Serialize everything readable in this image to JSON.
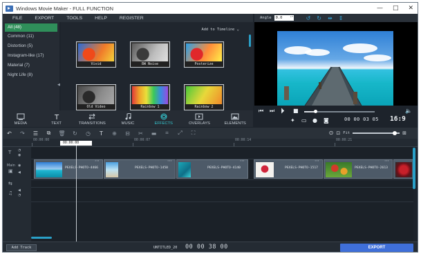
{
  "window": {
    "title": "Windows Movie Maker - FULL FUNCTION",
    "controls": [
      "—",
      "□",
      "✕"
    ]
  },
  "menu": [
    "FILE",
    "EXPORT",
    "TOOLS",
    "HELP",
    "REGISTER"
  ],
  "categories": [
    {
      "label": "All (48)",
      "active": true
    },
    {
      "label": "Common (11)"
    },
    {
      "label": "Distortion (5)"
    },
    {
      "label": "Instagram-like (17)"
    },
    {
      "label": "Material (7)"
    },
    {
      "label": "Night Life (8)"
    }
  ],
  "library": {
    "add_to_timeline": "Add to Timeline",
    "effects": [
      {
        "label": "Vivid",
        "style": "vivid"
      },
      {
        "label": "BW Noise",
        "style": "bw"
      },
      {
        "label": "Posterize",
        "style": "poster"
      },
      {
        "label": "Old Video",
        "style": "old"
      },
      {
        "label": "Rainbow 1",
        "style": "rainbow"
      },
      {
        "label": "Rainbow 2",
        "style": "rainbow2"
      }
    ]
  },
  "tabs": [
    {
      "label": "MEDIA",
      "icon": "media-icon"
    },
    {
      "label": "TEXT",
      "icon": "text-icon"
    },
    {
      "label": "TRANSITIONS",
      "icon": "transitions-icon"
    },
    {
      "label": "MUSIC",
      "icon": "music-icon"
    },
    {
      "label": "EFFECTS",
      "icon": "effects-icon",
      "active": true
    },
    {
      "label": "OVERLAYS",
      "icon": "overlays-icon"
    },
    {
      "label": "ELEMENTS",
      "icon": "elements-icon"
    }
  ],
  "preview": {
    "angle_label": "Angle",
    "angle_value": "0.0",
    "timecode": "00 00 03 05",
    "total_time": "16:9",
    "progress": 0.16
  },
  "timeline": {
    "ruler": [
      "00:00:00",
      "00:00:07",
      "00:00:14",
      "00:00:21"
    ],
    "playhead": "00:00:00",
    "zoom_label": "Fit",
    "clips": [
      {
        "name": "PEXELS-PHOTO-4466",
        "thumb": "sea"
      },
      {
        "name": "PEXELS-PHOTO-1450",
        "thumb": "beach"
      },
      {
        "name": "PEXELS-PHOTO-4140",
        "thumb": "aqua"
      },
      {
        "name": "PEXELS-PHOTO-1517",
        "thumb": "rose"
      },
      {
        "name": "PEXELS-PHOTO-2613",
        "thumb": "flowers"
      },
      {
        "name": "",
        "thumb": "red"
      }
    ]
  },
  "bottom": {
    "add_track": "Add Track",
    "project_name": "UNTITLED_20",
    "project_time": "00 00 38 00",
    "export": "EXPORT"
  },
  "colors": {
    "accent": "#35c9d2",
    "category_active": "#2f8f5a",
    "export": "#3f6fd9",
    "scrollbar": "#2aa0c8"
  }
}
